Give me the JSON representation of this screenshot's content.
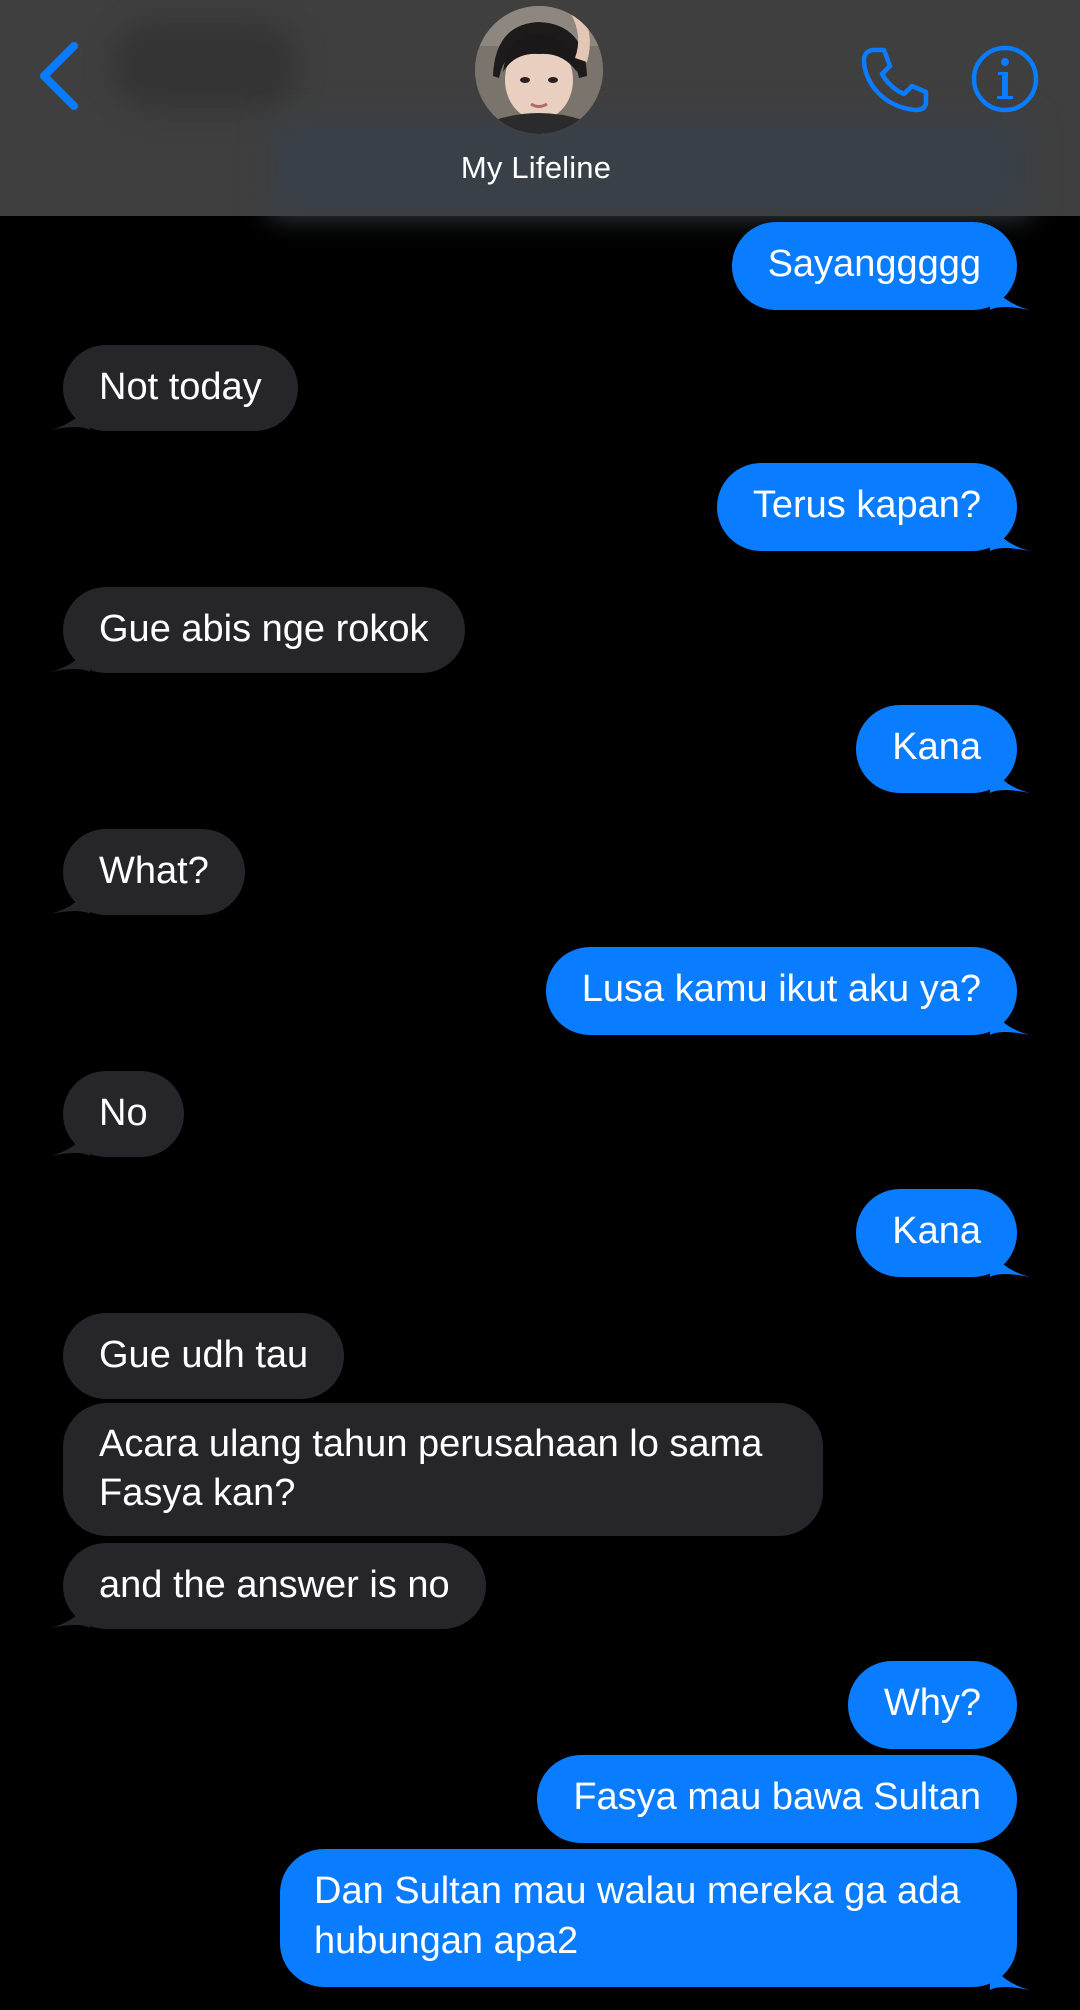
{
  "header": {
    "contact_name": "My Lifeline"
  },
  "colors": {
    "sent_bubble": "#0a7cff",
    "received_bubble": "#262529",
    "accent": "#0a7cff",
    "header_background": "#3f3f3f"
  },
  "icons": {
    "back": "chevron-left-icon",
    "phone": "phone-icon",
    "info": "info-icon"
  },
  "messages": [
    {
      "direction": "sent",
      "text": "Sayanggggg"
    },
    {
      "direction": "received",
      "text": "Not today"
    },
    {
      "direction": "sent",
      "text": "Terus kapan?"
    },
    {
      "direction": "received",
      "text": "Gue abis nge rokok"
    },
    {
      "direction": "sent",
      "text": "Kana"
    },
    {
      "direction": "received",
      "text": "What?"
    },
    {
      "direction": "sent",
      "text": "Lusa kamu ikut aku ya?"
    },
    {
      "direction": "received",
      "text": "No"
    },
    {
      "direction": "sent",
      "text": "Kana"
    },
    {
      "direction": "received",
      "text": "Gue udh tau"
    },
    {
      "direction": "received",
      "text": "Acara ulang tahun perusahaan lo sama Fasya kan?"
    },
    {
      "direction": "received",
      "text": "and the answer is no"
    },
    {
      "direction": "sent",
      "text": "Why?"
    },
    {
      "direction": "sent",
      "text": "Fasya mau bawa Sultan"
    },
    {
      "direction": "sent",
      "text": "Dan Sultan mau walau mereka ga ada hubungan apa2"
    }
  ]
}
